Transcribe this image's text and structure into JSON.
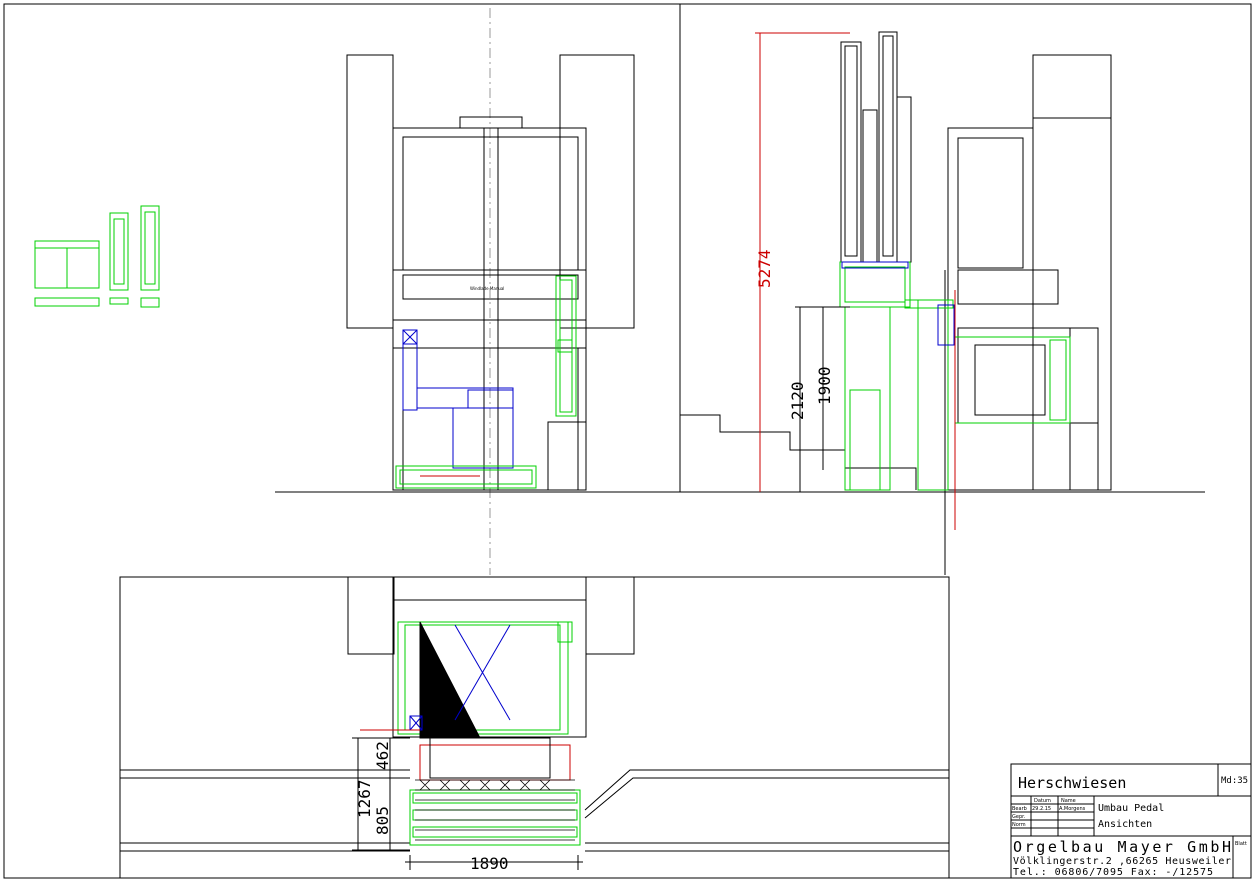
{
  "title_block": {
    "project": "Herschwiesen",
    "scale": "Md:35",
    "headers": {
      "datum": "Datum",
      "name": "Name"
    },
    "rows": [
      {
        "label": "Bearb",
        "datum": "29.2.15",
        "name": "A.Morgens"
      },
      {
        "label": "Gepr.",
        "datum": "",
        "name": ""
      },
      {
        "label": "Norm",
        "datum": "",
        "name": ""
      }
    ],
    "description_1": "Umbau Pedal",
    "description_2": "Ansichten",
    "company": "Orgelbau Mayer GmbH",
    "address": "Völklingerstr.2 ,66265 Heusweiler",
    "phone": "Tel.: 06806/7095   Fax: -/12575",
    "sheet_label": "Blatt"
  },
  "dimensions": {
    "overall_height": "5274",
    "height_a": "2120",
    "height_b": "1900",
    "depth_total": "1267",
    "depth_a": "462",
    "depth_b": "805",
    "width": "1890"
  },
  "labels": {
    "front_panel_text": "Windlade Manual"
  },
  "colors": {
    "structure": "#000000",
    "organ_parts": "#00d000",
    "pipes": "#0000cc",
    "dimension": "#cc0000",
    "centerline": "#999999"
  }
}
